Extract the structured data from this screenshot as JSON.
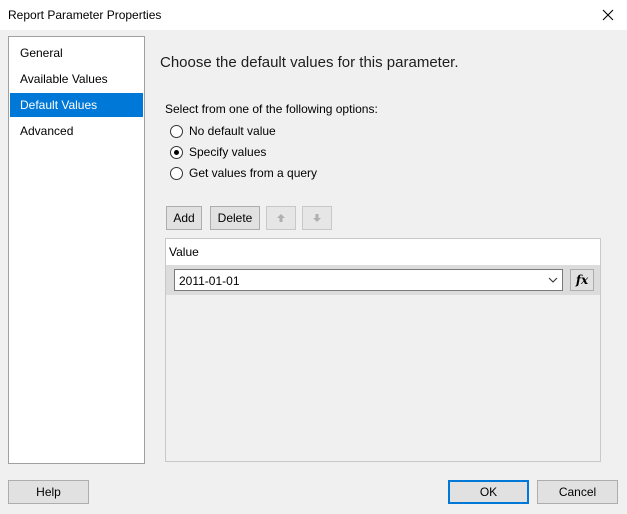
{
  "window": {
    "title": "Report Parameter Properties"
  },
  "nav": {
    "items": [
      {
        "label": "General",
        "selected": false
      },
      {
        "label": "Available Values",
        "selected": false
      },
      {
        "label": "Default Values",
        "selected": true
      },
      {
        "label": "Advanced",
        "selected": false
      }
    ]
  },
  "content": {
    "headline": "Choose the default values for this parameter.",
    "options_label": "Select from one of the following options:",
    "options": [
      {
        "label": "No default value",
        "checked": false
      },
      {
        "label": "Specify values",
        "checked": true
      },
      {
        "label": "Get values from a query",
        "checked": false
      }
    ],
    "toolbar": {
      "add_label": "Add",
      "delete_label": "Delete"
    },
    "grid": {
      "header": "Value",
      "rows": [
        {
          "value": "2011-01-01",
          "expr_label": "fx"
        }
      ]
    }
  },
  "footer": {
    "help_label": "Help",
    "ok_label": "OK",
    "cancel_label": "Cancel"
  },
  "colors": {
    "selection": "#0078d7",
    "window_bg": "#f0f0f0"
  }
}
